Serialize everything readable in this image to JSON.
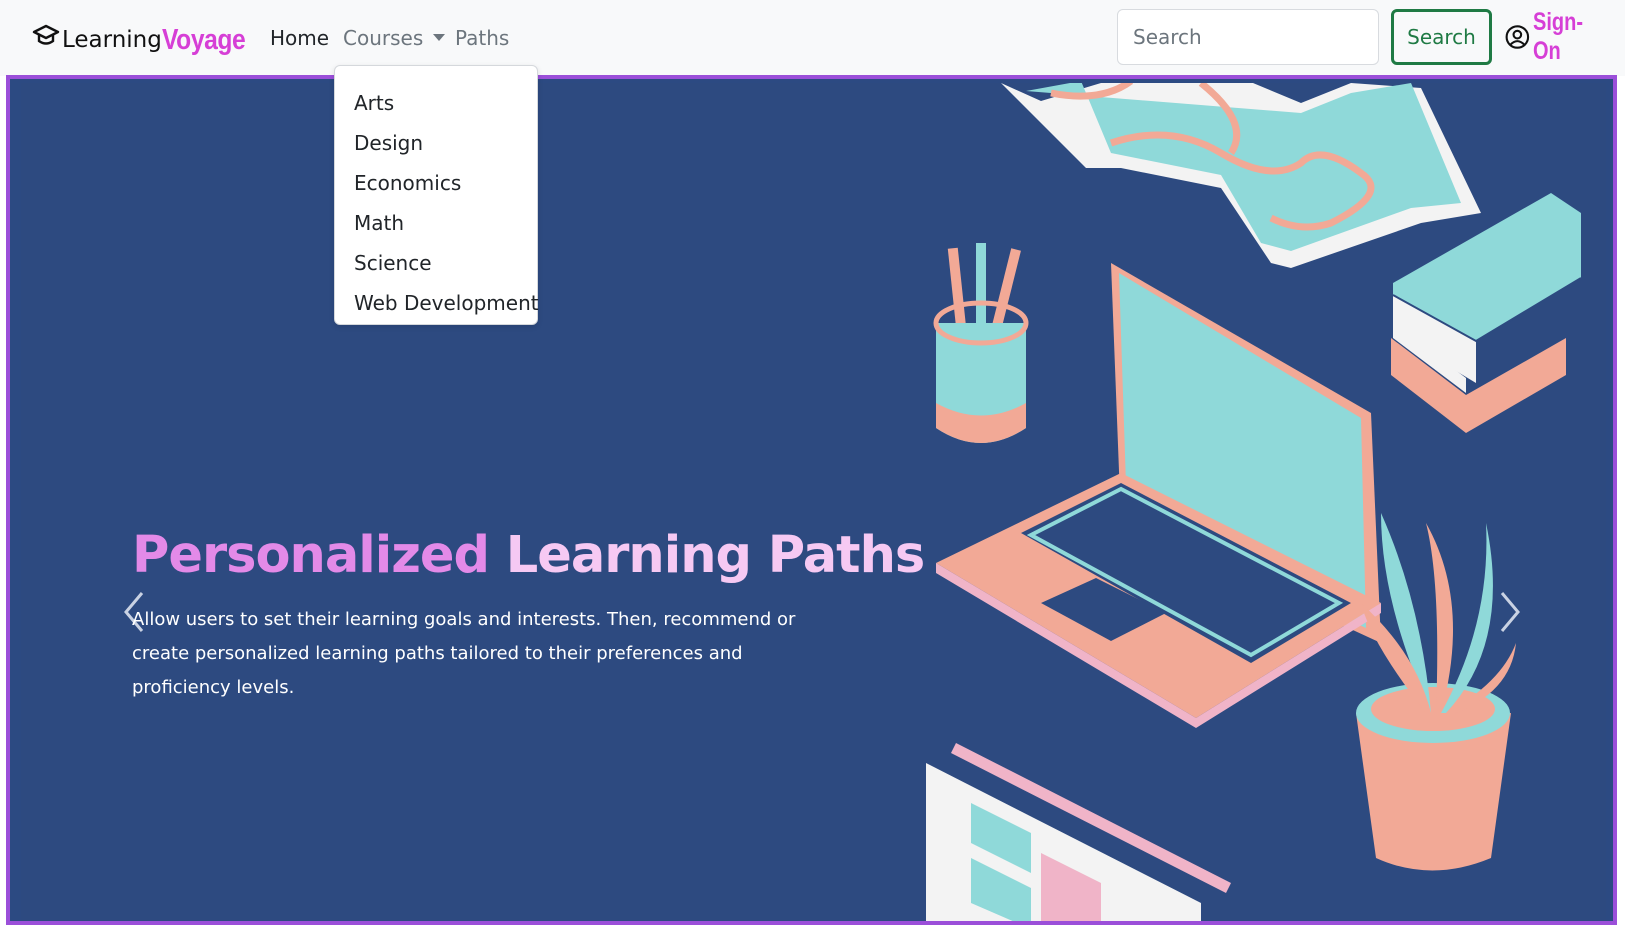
{
  "brand": {
    "part1": "Learning",
    "part2": "Voyage",
    "icon": "graduation-cap-icon"
  },
  "nav": {
    "home": "Home",
    "courses": "Courses",
    "paths": "Paths"
  },
  "courses_menu": [
    "Arts",
    "Design",
    "Economics",
    "Math",
    "Science",
    "Web Development"
  ],
  "search": {
    "placeholder": "Search",
    "button": "Search"
  },
  "account": {
    "label": "Sign-On",
    "icon": "user-circle-icon"
  },
  "hero": {
    "title_part1": "Personalized",
    "title_part2": "Learning Paths",
    "text": "Allow users to set their learning goals and interests. Then, recommend or create personalized learning paths tailored to their preferences and proficiency levels."
  },
  "colors": {
    "accent": "#d63fd6",
    "hero_bg": "#2d4a80",
    "frame": "#9b4fd9",
    "search_button": "#1f7a44",
    "art_teal": "#8fd9d9",
    "art_salmon": "#f2a996"
  }
}
